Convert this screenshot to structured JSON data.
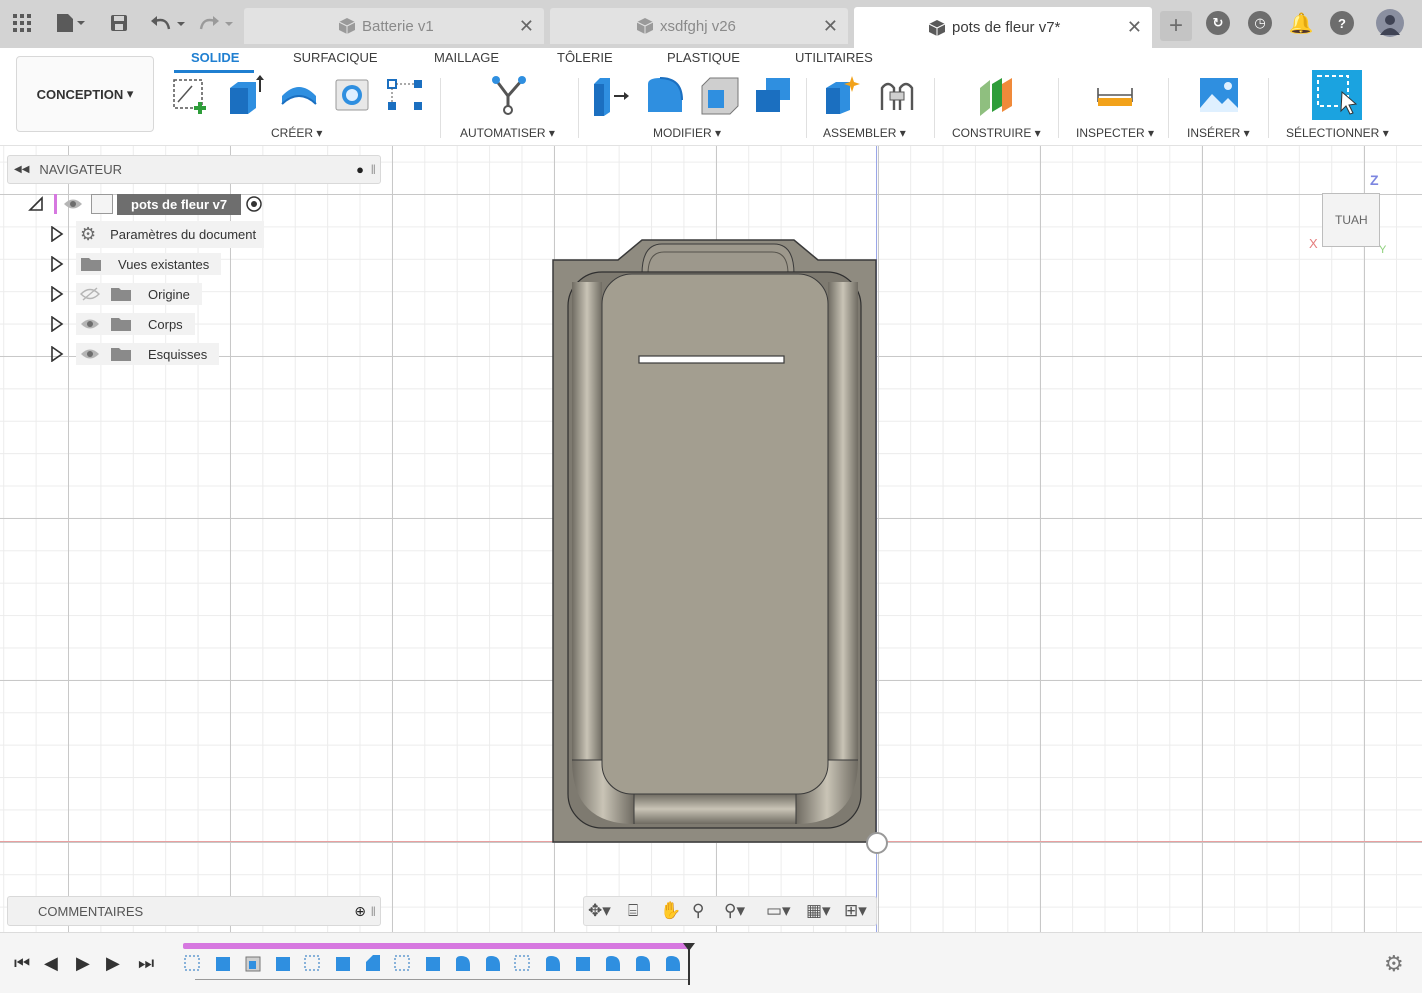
{
  "tabs": [
    {
      "label": "Batterie v1",
      "active": false
    },
    {
      "label": "xsdfghj v26",
      "active": false
    },
    {
      "label": "pots de fleur v7*",
      "active": true
    }
  ],
  "toolbar": {
    "workspace": "CONCEPTION",
    "tabs": [
      "SOLIDE",
      "SURFACIQUE",
      "MAILLAGE",
      "TÔLERIE",
      "PLASTIQUE",
      "UTILITAIRES"
    ],
    "groups": {
      "create": "CRÉER",
      "automate": "AUTOMATISER",
      "modify": "MODIFIER",
      "assemble": "ASSEMBLER",
      "construct": "CONSTRUIRE",
      "inspect": "INSPECTER",
      "insert": "INSÉRER",
      "select": "SÉLECTIONNER"
    }
  },
  "navigator": {
    "title": "NAVIGATEUR",
    "root": "pots de fleur v7",
    "items": [
      {
        "label": "Paramètres du document",
        "icon": "gear-icon",
        "visible_toggle": false
      },
      {
        "label": "Vues existantes",
        "icon": "folder-icon",
        "visible_toggle": false
      },
      {
        "label": "Origine",
        "icon": "folder-icon",
        "visible_toggle": true,
        "hidden": true
      },
      {
        "label": "Corps",
        "icon": "folder-icon",
        "visible_toggle": true,
        "hidden": false
      },
      {
        "label": "Esquisses",
        "icon": "folder-icon",
        "visible_toggle": true,
        "hidden": false
      }
    ]
  },
  "comments": {
    "title": "COMMENTAIRES"
  },
  "viewcube": {
    "face": "HAUT",
    "axis_x": "X",
    "axis_y": "Y",
    "axis_z": "Z"
  },
  "colors": {
    "accent": "#1f7fd1",
    "model_body": "#8f8b80",
    "model_inner": "#a39e90",
    "timeline_bar": "#d678e0",
    "axis_x": "#e8a0a0",
    "axis_z": "#9aa6e8"
  }
}
